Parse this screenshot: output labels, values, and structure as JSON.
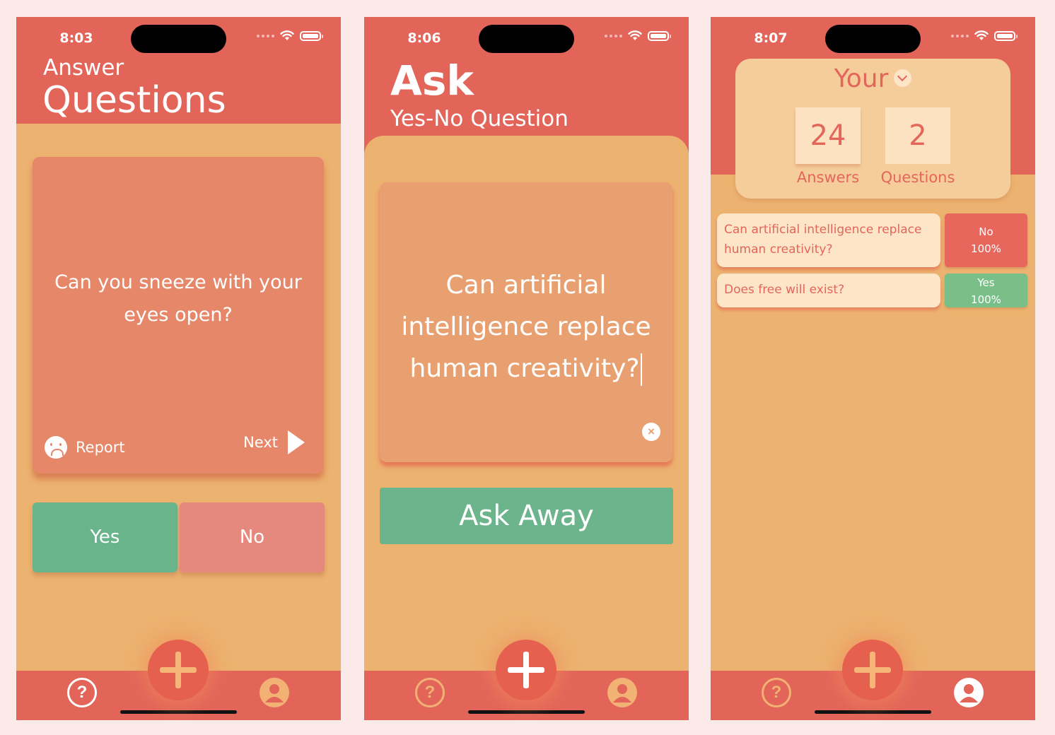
{
  "screens": {
    "answer": {
      "time": "8:03",
      "title_small": "Answer",
      "title_big": "Questions",
      "question": "Can you sneeze with your eyes open?",
      "report_label": "Report",
      "next_label": "Next",
      "yes_label": "Yes",
      "no_label": "No"
    },
    "ask": {
      "time": "8:06",
      "title_big": "Ask",
      "title_small": "Yes-No Question",
      "question_text": "Can artificial intelligence replace human creativity?",
      "clear_icon": "×",
      "button_label": "Ask Away"
    },
    "profile": {
      "time": "8:07",
      "dropdown_label": "Your",
      "answers_count": "24",
      "answers_label": "Answers",
      "questions_count": "2",
      "questions_label": "Questions",
      "questions": [
        {
          "text": "Can artificial intelligence replace human creativity?",
          "result": "No",
          "percent": "100%",
          "color": "#e8675c"
        },
        {
          "text": "Does free will exist?",
          "result": "Yes",
          "percent": "100%",
          "color": "#7bbf88"
        }
      ]
    }
  },
  "tabbar": {
    "help_glyph": "?",
    "icons": [
      "question-circle-icon",
      "plus-icon",
      "person-circle-icon"
    ]
  },
  "colors": {
    "header_red": "#e3655a",
    "body_orange": "#ecb26f",
    "yes_green": "#6ab48c",
    "no_red": "#e5887d"
  }
}
